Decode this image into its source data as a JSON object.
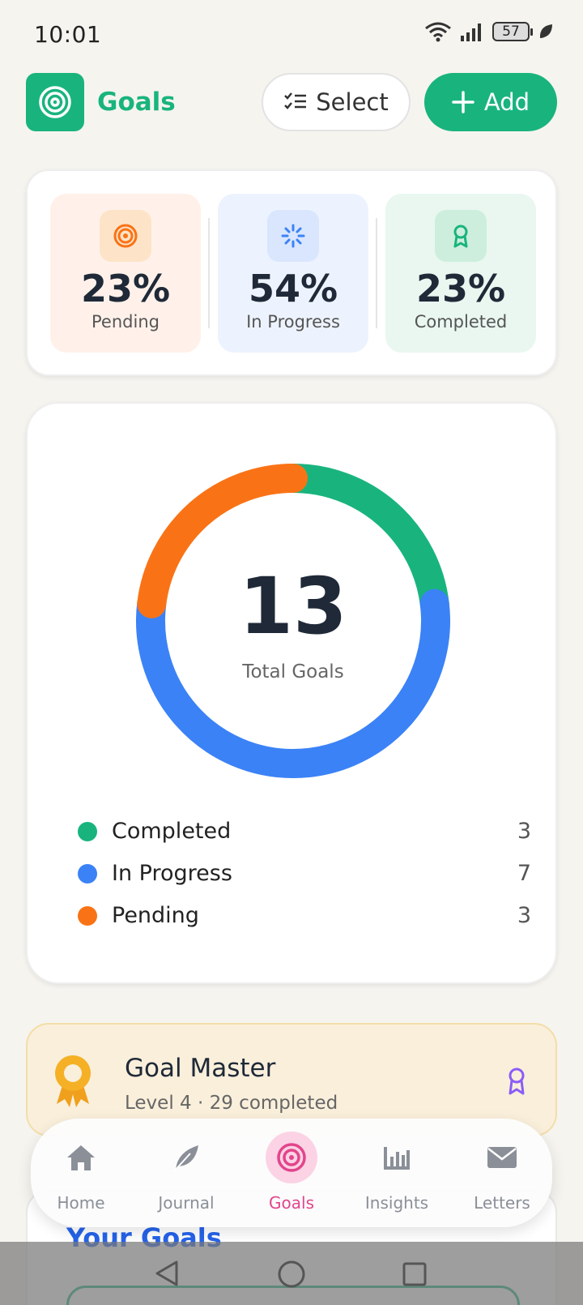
{
  "status": {
    "time": "10:01",
    "battery": "57"
  },
  "header": {
    "title": "Goals",
    "select_label": "Select",
    "add_label": "Add"
  },
  "stats": [
    {
      "pct": "23%",
      "label": "Pending",
      "color": "#f97316",
      "bg": "#fff1ea",
      "icon": "target-icon"
    },
    {
      "pct": "54%",
      "label": "In Progress",
      "color": "#3b82f6",
      "bg": "#edf3fe",
      "icon": "loader-icon"
    },
    {
      "pct": "23%",
      "label": "Completed",
      "color": "#19b47e",
      "bg": "#e9f7f0",
      "icon": "award-icon"
    }
  ],
  "summary": {
    "total": "13",
    "total_label": "Total Goals"
  },
  "chart_data": {
    "type": "pie",
    "categories": [
      "Completed",
      "In Progress",
      "Pending"
    ],
    "values": [
      3,
      7,
      3
    ],
    "colors": [
      "#19b47e",
      "#3b82f6",
      "#f97316"
    ]
  },
  "legend": [
    {
      "name": "Completed",
      "value": "3",
      "color": "#19b47e"
    },
    {
      "name": "In Progress",
      "value": "7",
      "color": "#3b82f6"
    },
    {
      "name": "Pending",
      "value": "3",
      "color": "#f97316"
    }
  ],
  "achievement": {
    "title": "Goal Master",
    "subtitle": "Level 4 · 29 completed"
  },
  "goals_section": {
    "title": "Your Goals"
  },
  "nav": [
    {
      "label": "Home",
      "icon": "home-icon"
    },
    {
      "label": "Journal",
      "icon": "feather-icon"
    },
    {
      "label": "Goals",
      "icon": "target-icon"
    },
    {
      "label": "Insights",
      "icon": "bar-chart-icon"
    },
    {
      "label": "Letters",
      "icon": "mail-icon"
    }
  ]
}
